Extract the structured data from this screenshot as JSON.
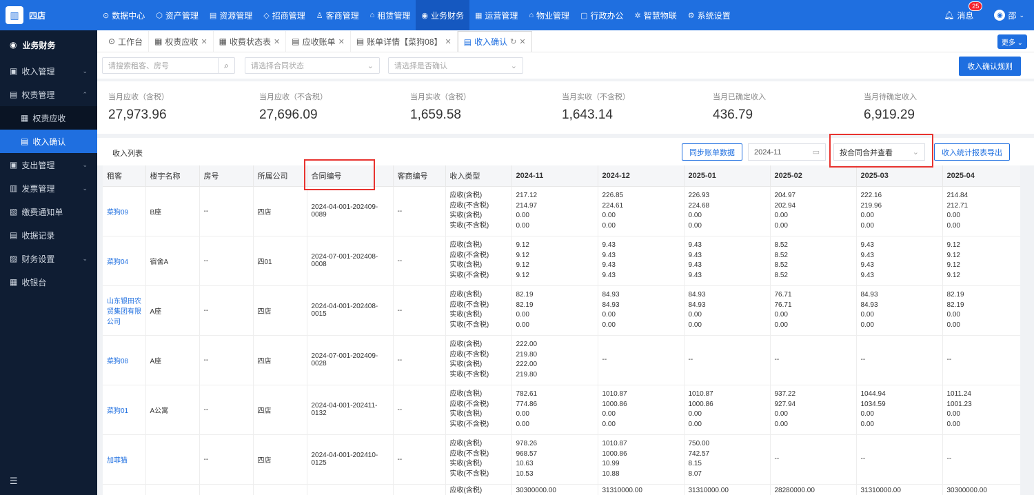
{
  "app": {
    "logo": "四店"
  },
  "nav": [
    {
      "icon": "⊙",
      "label": "数据中心"
    },
    {
      "icon": "⬡",
      "label": "资产管理"
    },
    {
      "icon": "▤",
      "label": "资源管理"
    },
    {
      "icon": "◇",
      "label": "招商管理"
    },
    {
      "icon": "♙",
      "label": "客商管理"
    },
    {
      "icon": "⌂",
      "label": "租赁管理"
    },
    {
      "icon": "◉",
      "label": "业务财务"
    },
    {
      "icon": "▦",
      "label": "运营管理"
    },
    {
      "icon": "⌂",
      "label": "物业管理"
    },
    {
      "icon": "▢",
      "label": "行政办公"
    },
    {
      "icon": "✲",
      "label": "智慧物联"
    },
    {
      "icon": "⚙",
      "label": "系统设置"
    }
  ],
  "header": {
    "messages": "消息",
    "badge": "25",
    "user": "邵"
  },
  "sidebar": {
    "head": "业务财务",
    "items": [
      {
        "label": "收入管理",
        "icon": "▣",
        "arrow": "⌄"
      },
      {
        "label": "权责管理",
        "icon": "▤",
        "arrow": "⌃"
      },
      {
        "label": "支出管理",
        "icon": "▣",
        "arrow": "⌄"
      },
      {
        "label": "发票管理",
        "icon": "▥",
        "arrow": "⌄"
      },
      {
        "label": "缴费通知单",
        "icon": "▧",
        "arrow": ""
      },
      {
        "label": "收据记录",
        "icon": "▤",
        "arrow": ""
      },
      {
        "label": "财务设置",
        "icon": "▨",
        "arrow": "⌄"
      },
      {
        "label": "收银台",
        "icon": "▦",
        "arrow": ""
      }
    ],
    "subs": [
      {
        "label": "权责应收",
        "icon": "▦"
      },
      {
        "label": "收入确认",
        "icon": "▤"
      }
    ]
  },
  "tabs": [
    {
      "icon": "⊙",
      "label": "工作台"
    },
    {
      "icon": "▦",
      "label": "权责应收"
    },
    {
      "icon": "▦",
      "label": "收费状态表"
    },
    {
      "icon": "▤",
      "label": "应收账单"
    },
    {
      "icon": "▤",
      "label": "账单详情【菜狗08】"
    },
    {
      "icon": "▤",
      "label": "收入确认"
    }
  ],
  "more": "更多 ⌄",
  "filters": {
    "search_placeholder": "请搜索租客、房号",
    "contract_status": "请选择合同状态",
    "confirm_status": "请选择是否确认",
    "rule_button": "收入确认规则"
  },
  "stats": [
    {
      "label": "当月应收（含税）",
      "value": "27,973.96"
    },
    {
      "label": "当月应收（不含税）",
      "value": "27,696.09"
    },
    {
      "label": "当月实收（含税）",
      "value": "1,659.58"
    },
    {
      "label": "当月实收（不含税）",
      "value": "1,643.14"
    },
    {
      "label": "当月已确定收入",
      "value": "436.79"
    },
    {
      "label": "当月待确定收入",
      "value": "6,919.29"
    }
  ],
  "list": {
    "title": "收入列表",
    "sync_button": "同步账单数据",
    "month": "2024-11",
    "mode": "按合同合并查看",
    "export_button": "收入统计报表导出"
  },
  "columns": [
    "租客",
    "楼宇名称",
    "房号",
    "所属公司",
    "合同编号",
    "客商编号",
    "收入类型"
  ],
  "months": [
    "2024-11",
    "2024-12",
    "2025-01",
    "2025-02",
    "2025-03",
    "2025-04"
  ],
  "types": [
    "应收(含税)",
    "应收(不含税)",
    "实收(含税)",
    "实收(不含税)"
  ],
  "rows": [
    {
      "tenant": "菜狗09",
      "building": "B座",
      "room": "--",
      "company": "四店",
      "contract": "2024-04-001-202409-0089",
      "merchant": "--",
      "vals": [
        [
          "217.12",
          "214.97",
          "0.00",
          "0.00"
        ],
        [
          "226.85",
          "224.61",
          "0.00",
          "0.00"
        ],
        [
          "226.93",
          "224.68",
          "0.00",
          "0.00"
        ],
        [
          "204.97",
          "202.94",
          "0.00",
          "0.00"
        ],
        [
          "222.16",
          "219.96",
          "0.00",
          "0.00"
        ],
        [
          "214.84",
          "212.71",
          "0.00",
          "0.00"
        ]
      ]
    },
    {
      "tenant": "菜狗04",
      "building": "宿舍A",
      "room": "--",
      "company": "四01",
      "contract": "2024-07-001-202408-0008",
      "merchant": "--",
      "vals": [
        [
          "9.12",
          "9.12",
          "9.12",
          "9.12"
        ],
        [
          "9.43",
          "9.43",
          "9.43",
          "9.43"
        ],
        [
          "9.43",
          "9.43",
          "9.43",
          "9.43"
        ],
        [
          "8.52",
          "8.52",
          "8.52",
          "8.52"
        ],
        [
          "9.43",
          "9.43",
          "9.43",
          "9.43"
        ],
        [
          "9.12",
          "9.12",
          "9.12",
          "9.12"
        ]
      ]
    },
    {
      "tenant": "山东银田农贸集团有限公司",
      "building": "A座",
      "room": "--",
      "company": "四店",
      "contract": "2024-04-001-202408-0015",
      "merchant": "--",
      "vals": [
        [
          "82.19",
          "82.19",
          "0.00",
          "0.00"
        ],
        [
          "84.93",
          "84.93",
          "0.00",
          "0.00"
        ],
        [
          "84.93",
          "84.93",
          "0.00",
          "0.00"
        ],
        [
          "76.71",
          "76.71",
          "0.00",
          "0.00"
        ],
        [
          "84.93",
          "84.93",
          "0.00",
          "0.00"
        ],
        [
          "82.19",
          "82.19",
          "0.00",
          "0.00"
        ]
      ]
    },
    {
      "tenant": "菜狗08",
      "building": "A座",
      "room": "--",
      "company": "四店",
      "contract": "2024-07-001-202409-0028",
      "merchant": "--",
      "vals": [
        [
          "222.00",
          "219.80",
          "222.00",
          "219.80"
        ],
        "--",
        "--",
        "--",
        "--",
        "--"
      ]
    },
    {
      "tenant": "菜狗01",
      "building": "A公寓",
      "room": "--",
      "company": "四店",
      "contract": "2024-04-001-202411-0132",
      "merchant": "--",
      "vals": [
        [
          "782.61",
          "774.86",
          "0.00",
          "0.00"
        ],
        [
          "1010.87",
          "1000.86",
          "0.00",
          "0.00"
        ],
        [
          "1010.87",
          "1000.86",
          "0.00",
          "0.00"
        ],
        [
          "937.22",
          "927.94",
          "0.00",
          "0.00"
        ],
        [
          "1044.94",
          "1034.59",
          "0.00",
          "0.00"
        ],
        [
          "1011.24",
          "1001.23",
          "0.00",
          "0.00"
        ]
      ]
    },
    {
      "tenant": "加菲猫",
      "building": "",
      "room": "--",
      "company": "四店",
      "contract": "2024-04-001-202410-0125",
      "merchant": "--",
      "vals": [
        [
          "978.26",
          "968.57",
          "10.63",
          "10.53"
        ],
        [
          "1010.87",
          "1000.86",
          "10.99",
          "10.88"
        ],
        [
          "750.00",
          "742.57",
          "8.15",
          "8.07"
        ],
        "--",
        "--",
        "--"
      ]
    },
    {
      "tenant": "",
      "building": "",
      "room": "",
      "company": "",
      "contract": "",
      "merchant": "",
      "vals": [
        [
          "30300000.00"
        ],
        [
          "31310000.00"
        ],
        [
          "31310000.00"
        ],
        [
          "28280000.00"
        ],
        [
          "31310000.00"
        ],
        [
          "30300000.00"
        ]
      ],
      "types": [
        "应收(含税)"
      ]
    }
  ]
}
